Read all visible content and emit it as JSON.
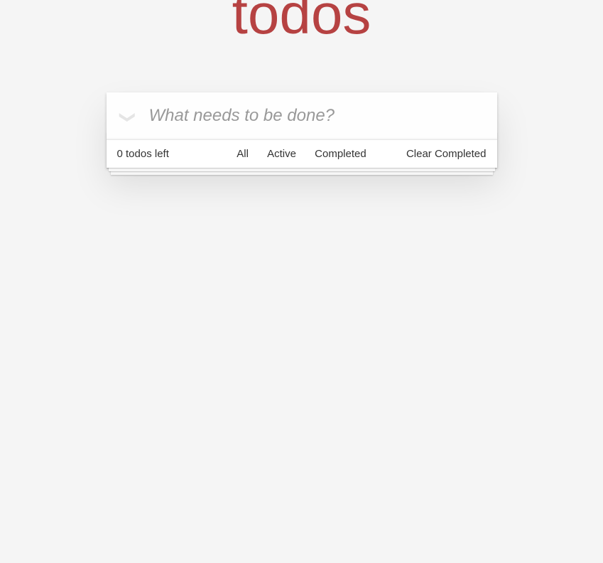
{
  "header": {
    "title": "todos",
    "input_placeholder": "What needs to be done?"
  },
  "footer": {
    "count_text": "0 todos left",
    "filters": {
      "all": "All",
      "active": "Active",
      "completed": "Completed"
    },
    "clear_label": "Clear Completed"
  }
}
